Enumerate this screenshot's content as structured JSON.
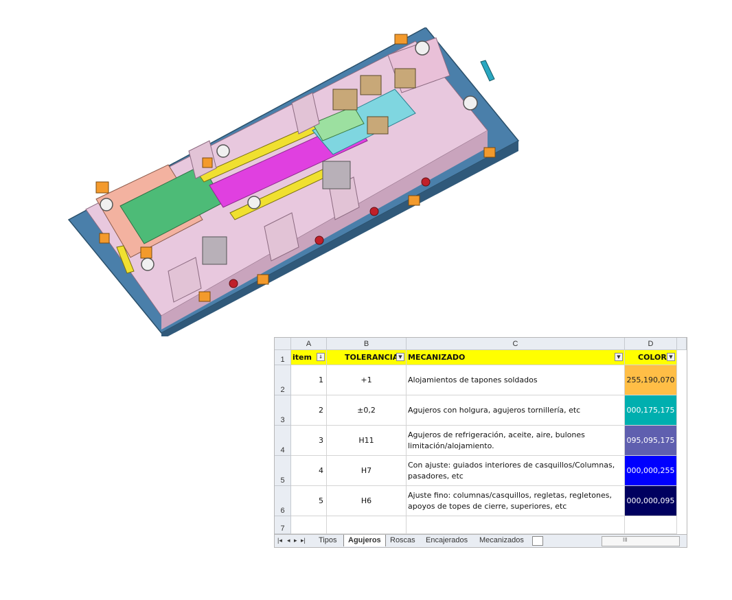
{
  "sheet": {
    "columns": [
      "A",
      "B",
      "C",
      "D"
    ],
    "rows": [
      "1",
      "2",
      "3",
      "4",
      "5",
      "6",
      "7"
    ],
    "header": {
      "item": "item",
      "tolerancia": "TOLERANCIA",
      "mecanizado": "MECANIZADO",
      "color": "COLOR"
    },
    "data": [
      {
        "item": "1",
        "tol": "+1",
        "mec1": "Alojamientos de tapones soldados",
        "mec2": "",
        "color": "255,190,070",
        "bg": "#ffbe46",
        "fg": "#222222"
      },
      {
        "item": "2",
        "tol": "±0,2",
        "mec1": "Agujeros con holgura, agujeros tornillería, etc",
        "mec2": "",
        "color": "000,175,175",
        "bg": "#00afaf",
        "fg": "#ffffff"
      },
      {
        "item": "3",
        "tol": "H11",
        "mec1": "Agujeros de refrigeración, aceite, aire, bulones",
        "mec2": "limitación/alojamiento.",
        "color": "095,095,175",
        "bg": "#5f5faf",
        "fg": "#ffffff"
      },
      {
        "item": "4",
        "tol": "H7",
        "mec1": "Con ajuste: guiados interiores de casquillos/Columnas,",
        "mec2": "pasadores, etc",
        "color": "000,000,255",
        "bg": "#0000ff",
        "fg": "#ffffff"
      },
      {
        "item": "5",
        "tol": "H6",
        "mec1": "Ajuste fino: columnas/casquillos, regletas, regletones,",
        "mec2": "apoyos de topes de cierre, superiores, etc",
        "color": "000,000,095",
        "bg": "#00005f",
        "fg": "#ffffff"
      }
    ],
    "tabs": [
      "Tipos",
      "Agujeros",
      "Roscas",
      "Encajerados",
      "Mecanizados"
    ],
    "active_tab": "Agujeros",
    "hscroll_label": "III"
  }
}
